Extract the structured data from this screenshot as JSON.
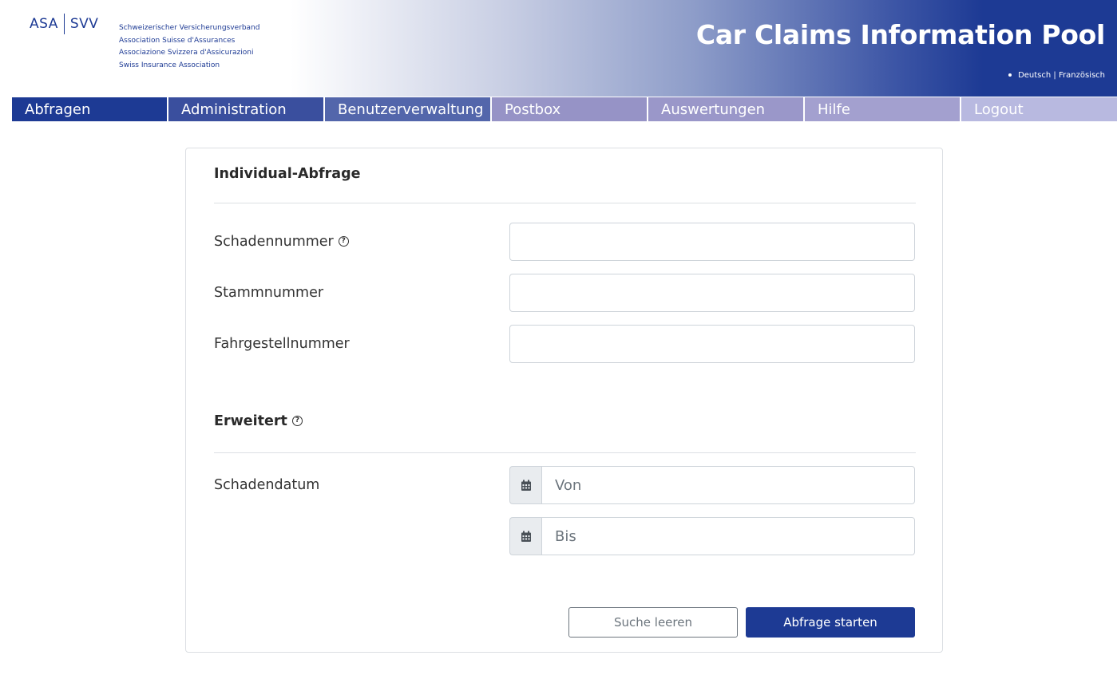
{
  "header": {
    "logo_left": "ASA",
    "logo_right": "SVV",
    "org_lines": [
      "Schweizerischer Versicherungsverband",
      "Association Suisse d'Assurances",
      "Associazione Svizzera d'Assicurazioni",
      "Swiss Insurance Association"
    ],
    "app_title": "Car Claims Information Pool",
    "lang_current": "Deutsch",
    "lang_separator": "|",
    "lang_other": "Französisch"
  },
  "nav": {
    "items": [
      {
        "label": "Abfragen",
        "color": "#1d3a94"
      },
      {
        "label": "Administration",
        "color": "#3a4f9e"
      },
      {
        "label": "Benutzerverwaltung",
        "color": "#5366ab"
      },
      {
        "label": "Postbox",
        "color": "#9693c6"
      },
      {
        "label": "Auswertungen",
        "color": "#9a97c9"
      },
      {
        "label": "Hilfe",
        "color": "#a3a0cf"
      },
      {
        "label": "Logout",
        "color": "#b8b9e0"
      }
    ]
  },
  "form": {
    "section1_title": "Individual-Abfrage",
    "fields": [
      {
        "label": "Schadennummer",
        "help": true,
        "value": ""
      },
      {
        "label": "Stammnummer",
        "help": false,
        "value": ""
      },
      {
        "label": "Fahrgestellnummer",
        "help": false,
        "value": ""
      }
    ],
    "help_glyph": "?",
    "section2_title": "Erweitert",
    "date_label": "Schadendatum",
    "date_from_placeholder": "Von",
    "date_to_placeholder": "Bis",
    "clear_button": "Suche leeren",
    "submit_button": "Abfrage starten"
  },
  "colors": {
    "brand": "#1d3a94",
    "border": "#ced4da"
  }
}
